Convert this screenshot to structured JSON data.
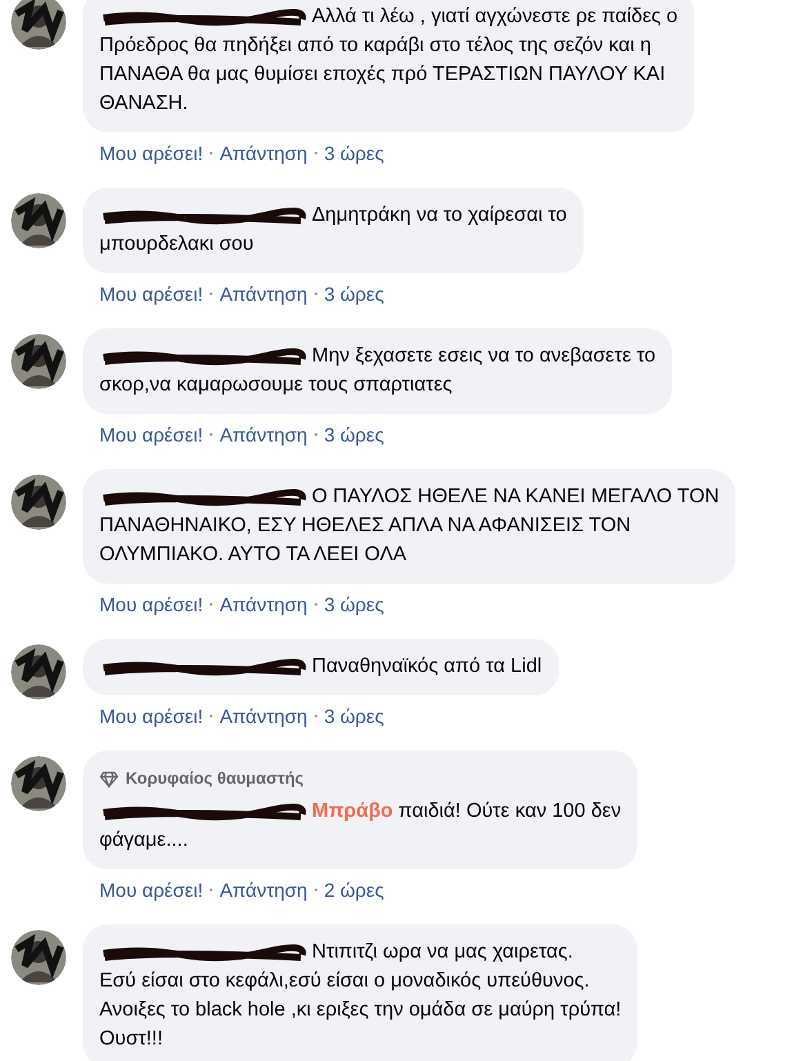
{
  "comments": [
    {
      "lead": "Αλλά τι λέω , γιατί αγχώνεστε ρε παίδες ο",
      "text": "Πρόεδρος θα πηδήξει από το καράβι στο τέλος της σεζόν και η\nΠΑΝΑΘΑ θα μας θυμίσει εποχές πρό ΤΕΡΑΣΤΙΩΝ ΠΑΥΛΟΥ ΚΑΙ\nΘΑΝΑΣΗ.",
      "like": "Μου αρέσει!",
      "reply": "Απάντηση",
      "time": "3 ώρες"
    },
    {
      "lead": "Δημητράκη να το χαίρεσαι το",
      "text": "μπουρδελακι σου",
      "like": "Μου αρέσει!",
      "reply": "Απάντηση",
      "time": "3 ώρες"
    },
    {
      "lead": "Μην ξεχασετε εσεις να το ανεβασετε το",
      "text": "σκορ,να καμαρωσουμε τους σπαρτιατες",
      "like": "Μου αρέσει!",
      "reply": "Απάντηση",
      "time": "3 ώρες"
    },
    {
      "lead": "Ο ΠΑΥΛΟΣ ΗΘΕΛΕ ΝΑ ΚΑΝΕΙ ΜΕΓΑΛΟ ΤΟΝ",
      "text": "ΠΑΝΑΘΗΝΑΙΚΟ, ΕΣΥ ΗΘΕΛΕΣ ΑΠΛΑ ΝΑ ΑΦΑΝΙΣΕΙΣ ΤΟΝ\nΟΛΥΜΠΙΑΚΟ. ΑΥΤΟ ΤΑ ΛΕΕΙ ΟΛΑ",
      "like": "Μου αρέσει!",
      "reply": "Απάντηση",
      "time": "3 ώρες"
    },
    {
      "lead": "Παναθηναϊκός από τα Lidl",
      "like": "Μου αρέσει!",
      "reply": "Απάντηση",
      "time": "3 ώρες"
    },
    {
      "badge": "Κορυφαίος θαυμαστής",
      "lead": "**Μπράβο** παιδιά! Ούτε καν 100 δεν",
      "text": "φάγαμε....",
      "like": "Μου αρέσει!",
      "reply": "Απάντηση",
      "time": "2 ώρες"
    },
    {
      "lead": "Ντιπιτζι ωρα να μας χαιρετας.",
      "text": "Εσύ είσαι στο κεφάλι,εσύ είσαι ο μοναδικός υπεύθυνος.\nΑνοιξες το black hole ,κι εριξες την ομάδα σε μαύρη τρύπα!\nΟυστ!!!"
    }
  ]
}
